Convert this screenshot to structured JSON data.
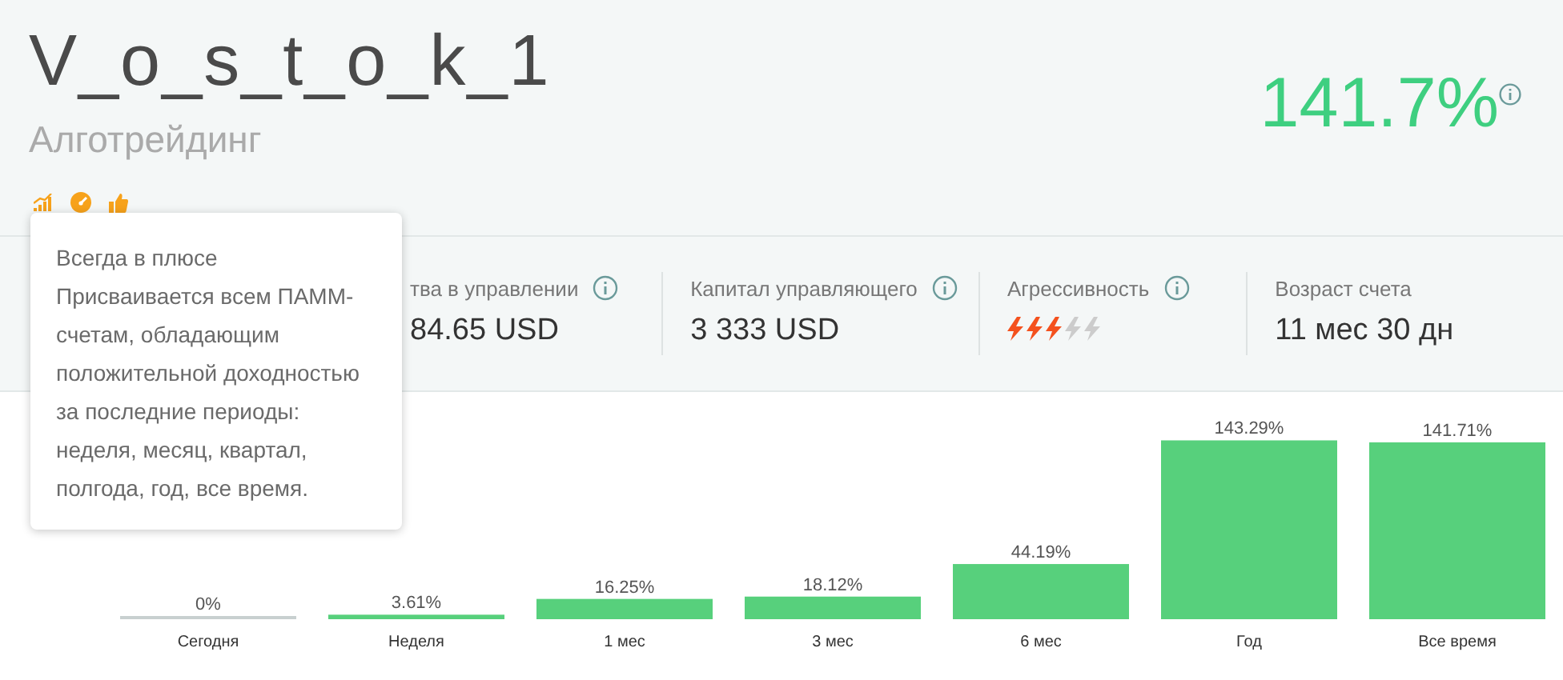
{
  "header": {
    "title": "V_o_s_t_o_k_1",
    "subtitle": "Алготрейдинг",
    "return": "141.7%"
  },
  "tooltip": {
    "title": "Всегда в плюсе",
    "text": "Присваивается всем ПАММ-счетам, обладающим положительной доходностью за последние периоды: неделя, месяц, квартал, полгода, год, все время."
  },
  "stats": [
    {
      "kind": "text",
      "label": "тва в управлении",
      "value": "84.65 USD",
      "info": true
    },
    {
      "kind": "text",
      "label": "Капитал управляющего",
      "value": "3 333 USD",
      "info": true
    },
    {
      "kind": "rating",
      "label": "Агрессивность",
      "stars": 3,
      "info": true
    },
    {
      "kind": "text",
      "label": "Возраст счета",
      "value": "11 мес 30 дн",
      "info": false
    }
  ],
  "chart_data": {
    "type": "bar",
    "categories": [
      "Сегодня",
      "Неделя",
      "1 мес",
      "3 мес",
      "6 мес",
      "Год",
      "Все время"
    ],
    "values": [
      0,
      3.61,
      16.25,
      18.12,
      44.19,
      143.29,
      141.71
    ],
    "value_labels": [
      "0%",
      "3.61%",
      "16.25%",
      "18.12%",
      "44.19%",
      "143.29%",
      "141.71%"
    ]
  }
}
